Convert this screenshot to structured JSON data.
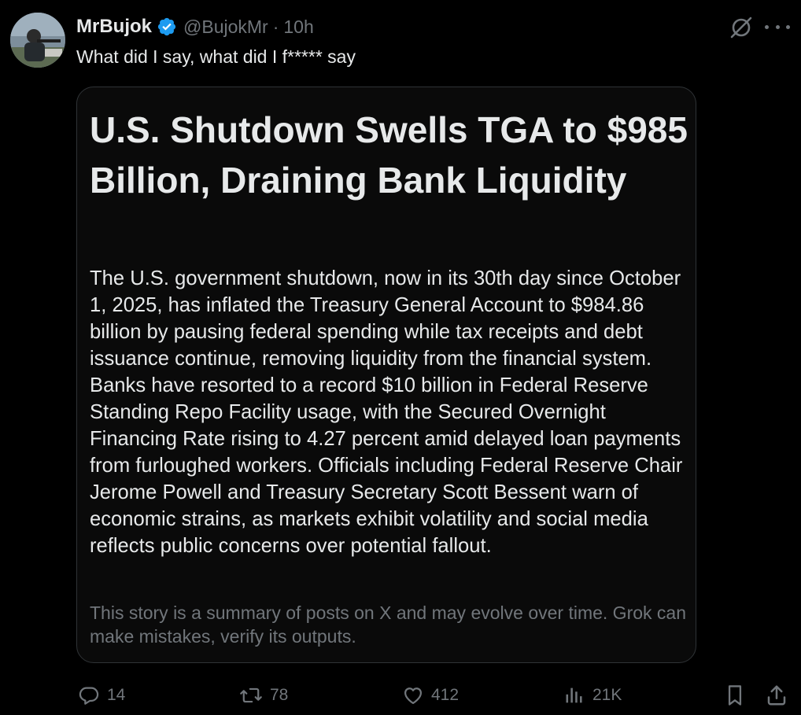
{
  "tweet": {
    "author": {
      "display_name": "MrBujok",
      "handle": "@BujokMr",
      "verified": true,
      "avatar": "avatar-photo"
    },
    "separator": "·",
    "time": "10h",
    "text": "What did I say, what did I f***** say"
  },
  "header_icons": [
    "grok-icon",
    "more-icon"
  ],
  "card": {
    "title": "U.S. Shutdown Swells TGA to $985 Billion, Draining Bank Liquidity",
    "body": "The U.S. government shutdown, now in its 30th day since October 1, 2025, has inflated the Treasury General Account to $984.86 billion by pausing federal spending while tax receipts and debt issuance continue, removing liquidity from the financial system. Banks have resorted to a record $10 billion in Federal Reserve Standing Repo Facility usage, with the Secured Overnight Financing Rate rising to 4.27 percent amid delayed loan payments from furloughed workers. Officials including Federal Reserve Chair Jerome Powell and Treasury Secretary Scott Bessent warn of economic strains, as markets exhibit volatility and social media reflects public concerns over potential fallout.",
    "disclaimer": "This story is a summary of posts on X and may evolve over time. Grok can make mistakes, verify its outputs."
  },
  "actions": {
    "replies": "14",
    "reposts": "78",
    "likes": "412",
    "views": "21K",
    "icons": [
      "reply-icon",
      "repost-icon",
      "like-icon",
      "views-icon",
      "bookmark-icon",
      "share-icon"
    ]
  },
  "colors": {
    "background": "#000000",
    "text_primary": "#e7e9ea",
    "text_secondary": "#71767b",
    "verified_badge": "#1d9bf0",
    "card_border": "#2f3336"
  }
}
